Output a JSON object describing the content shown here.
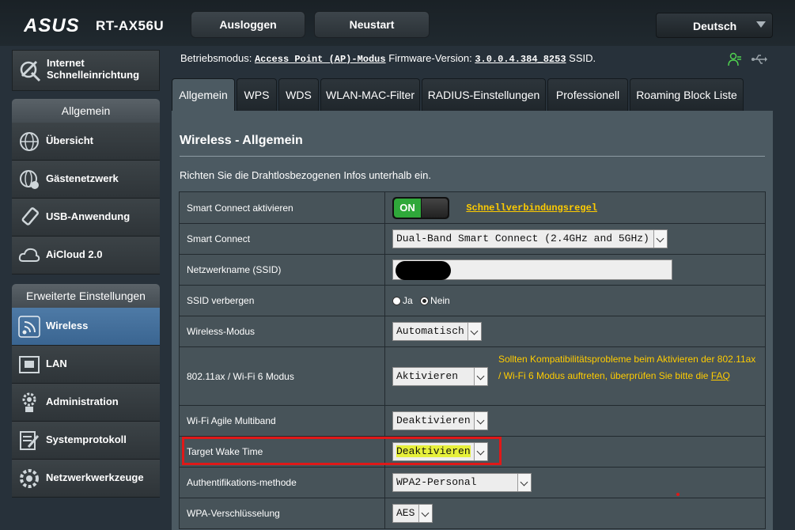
{
  "header": {
    "brand": "ASUS",
    "model": "RT-AX56U",
    "logout_label": "Ausloggen",
    "reboot_label": "Neustart",
    "language": "Deutsch"
  },
  "sidebar": {
    "quick_setup": [
      "Internet",
      "Schnelleinrichtung"
    ],
    "general_header": "Allgemein",
    "general_items": [
      "Übersicht",
      "Gästenetzwerk",
      "USB-Anwendung",
      "AiCloud 2.0"
    ],
    "advanced_header": "Erweiterte Einstellungen",
    "advanced_items": [
      "Wireless",
      "LAN",
      "Administration",
      "Systemprotokoll",
      "Netzwerkwerkzeuge"
    ]
  },
  "status": {
    "mode_label": "Betriebsmodus:",
    "mode_value": "Access Point (AP)-Modus",
    "fw_label": "Firmware-Version:",
    "fw_value": "3.0.0.4.384_8253",
    "ssid_label": "SSID."
  },
  "tabs": [
    "Allgemein",
    "WPS",
    "WDS",
    "WLAN-MAC-Filter",
    "RADIUS-Einstellungen",
    "Professionell",
    "Roaming Block Liste"
  ],
  "main": {
    "title": "Wireless - Allgemein",
    "description": "Richten Sie die Drahtlosbezogenen Infos unterhalb ein.",
    "rows": {
      "smart_connect_enable": {
        "label": "Smart Connect aktivieren",
        "toggle": "ON",
        "link": "Schnellverbindungsregel"
      },
      "smart_connect": {
        "label": "Smart Connect",
        "value": "Dual-Band Smart Connect (2.4GHz and 5GHz)"
      },
      "ssid": {
        "label": "Netzwerkname (SSID)"
      },
      "hide_ssid": {
        "label": "SSID verbergen",
        "opt_yes": "Ja",
        "opt_no": "Nein"
      },
      "wireless_mode": {
        "label": "Wireless-Modus",
        "value": "Automatisch"
      },
      "ax_mode": {
        "label": "802.11ax / Wi-Fi 6 Modus",
        "value": "Aktivieren",
        "warning": "Sollten Kompatibilitätsprobleme beim Aktivieren der 802.11ax / Wi-Fi 6 Modus auftreten, überprüfen Sie bitte die",
        "faq": "FAQ"
      },
      "agile_multiband": {
        "label": "Wi-Fi Agile Multiband",
        "value": "Deaktivieren"
      },
      "twt": {
        "label": "Target Wake Time",
        "value": "Deaktivieren"
      },
      "auth_method": {
        "label": "Authentifikations-methode",
        "value": "WPA2-Personal"
      },
      "wpa_encryption": {
        "label": "WPA-Verschlüsselung",
        "value": "AES"
      }
    }
  },
  "colors": {
    "accent_link": "#ffcc00",
    "toggle_on": "#2fa83a",
    "highlight_box": "#e01818",
    "active_menu": "#4e7aa6"
  }
}
